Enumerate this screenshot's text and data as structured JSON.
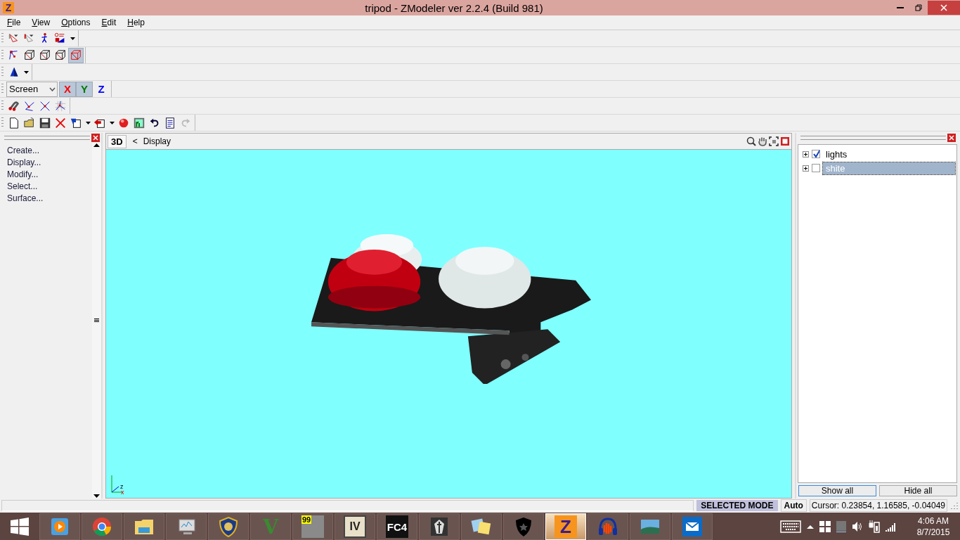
{
  "window": {
    "logo": "Z",
    "title": "tripod - ZModeler ver 2.2.4 (Build 981)"
  },
  "menu": [
    "File",
    "View",
    "Options",
    "Edit",
    "Help"
  ],
  "toolbars": [
    {
      "tools": [
        {
          "kind": "pick",
          "pressed": false
        },
        {
          "kind": "pick2",
          "pressed": false
        },
        {
          "kind": "figure",
          "pressed": false
        },
        {
          "kind": "gadget",
          "pressed": false
        },
        {
          "kind": "arrow",
          "pressed": false
        }
      ]
    },
    {
      "tools": [
        {
          "kind": "vertex",
          "pressed": false
        },
        {
          "kind": "cube",
          "pressed": false
        },
        {
          "kind": "cube",
          "pressed": false
        },
        {
          "kind": "cube",
          "pressed": false
        },
        {
          "kind": "cube-red",
          "pressed": true
        }
      ]
    },
    {
      "tools": [
        {
          "kind": "cone",
          "pressed": false
        },
        {
          "kind": "arrow",
          "pressed": false
        }
      ]
    },
    {
      "tools": [
        {
          "kind": "select",
          "value": "Screen"
        },
        {
          "kind": "axis",
          "label": "X",
          "color": "#ff0000",
          "pressed": true
        },
        {
          "kind": "axis",
          "label": "Y",
          "color": "#007a00",
          "pressed": true
        },
        {
          "kind": "axis",
          "label": "Z",
          "color": "#0000ff",
          "pressed": false
        }
      ]
    },
    {
      "tools": [
        {
          "kind": "magnet",
          "pressed": false
        },
        {
          "kind": "nodes",
          "pressed": false
        },
        {
          "kind": "nodes-cross",
          "pressed": false
        },
        {
          "kind": "grid-node",
          "pressed": false
        }
      ]
    },
    {
      "tools": [
        {
          "kind": "new",
          "pressed": false,
          "disabled": false
        },
        {
          "kind": "open",
          "pressed": false,
          "disabled": false
        },
        {
          "kind": "save",
          "pressed": false,
          "disabled": false
        },
        {
          "kind": "delete",
          "pressed": false,
          "disabled": false
        },
        {
          "kind": "import",
          "pressed": false,
          "disabled": false
        },
        {
          "kind": "arrow",
          "pressed": false,
          "disabled": false
        },
        {
          "kind": "export",
          "pressed": false,
          "disabled": false
        },
        {
          "kind": "arrow",
          "pressed": false,
          "disabled": false
        },
        {
          "kind": "sphere",
          "pressed": false,
          "disabled": false
        },
        {
          "kind": "picture",
          "pressed": false,
          "disabled": false
        },
        {
          "kind": "undo",
          "pressed": false,
          "disabled": false
        },
        {
          "kind": "notes",
          "pressed": false,
          "disabled": false
        },
        {
          "kind": "redo",
          "pressed": false,
          "disabled": true
        }
      ]
    }
  ],
  "command_panel": {
    "items": [
      "Create...",
      "Display...",
      "Modify...",
      "Select...",
      "Surface..."
    ]
  },
  "viewport": {
    "tab": "3D",
    "back": "<",
    "title": "Display",
    "axis_labels": [
      "z",
      "x"
    ]
  },
  "objects_panel": {
    "tree": [
      {
        "label": "lights",
        "checked": true,
        "selected": false
      },
      {
        "label": "shite",
        "checked": false,
        "selected": true
      }
    ],
    "buttons": [
      "Show all",
      "Hide all"
    ]
  },
  "status_bar": {
    "mode": "SELECTED MODE",
    "snap": "Auto",
    "cursor": "Cursor: 0.23854, 1.16585, -0.04049"
  },
  "taskbar": {
    "apps": [
      {
        "kind": "media",
        "active": false
      },
      {
        "kind": "chrome",
        "active": false
      },
      {
        "kind": "folder",
        "active": false
      },
      {
        "kind": "monitor",
        "active": false
      },
      {
        "kind": "badge",
        "active": false
      },
      {
        "kind": "letter",
        "label": "V",
        "active": false
      },
      {
        "kind": "screen",
        "label": "99",
        "active": false
      },
      {
        "kind": "tile",
        "label": "IV",
        "active": false
      },
      {
        "kind": "dark",
        "label": "FC4",
        "active": false
      },
      {
        "kind": "mask",
        "active": false
      },
      {
        "kind": "notes",
        "active": false
      },
      {
        "kind": "shield",
        "active": false
      },
      {
        "kind": "orange",
        "label": "Z",
        "active": true
      },
      {
        "kind": "headphones",
        "active": false
      },
      {
        "kind": "photo",
        "active": false
      },
      {
        "kind": "mail",
        "active": false
      }
    ],
    "time": "4:06 AM",
    "date": "8/7/2015"
  }
}
